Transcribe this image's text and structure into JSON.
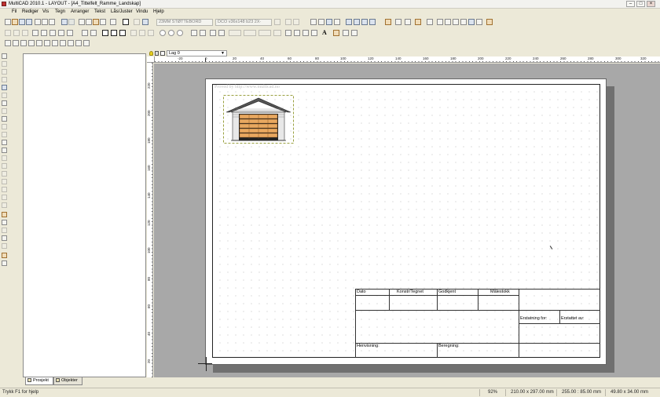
{
  "window": {
    "title": "MultiCAD 2010.1 - LAYOUT - [A4_Tittelfelt_Ramme_Landskap]",
    "buttons": [
      "–",
      "□",
      "×"
    ]
  },
  "menu": [
    "Fil",
    "Rediger",
    "Vis",
    "Tegn",
    "Arranger",
    "Tekst",
    "Lås/Juster",
    "Vindu",
    "Hjelp"
  ],
  "toolbar2": {
    "combo1": "23MM STØTTEBORD",
    "combo2": "DCO v36x148 b23 2X·",
    "text_tool": "A"
  },
  "draw_toolbar": {
    "layer": "Lag 0"
  },
  "ruler": {
    "h_labels": [
      "-20",
      "0",
      "20",
      "40",
      "60",
      "80",
      "100",
      "120",
      "140",
      "160",
      "180",
      "200",
      "220",
      "240",
      "260",
      "280",
      "300",
      "320"
    ],
    "v_labels": [
      "220",
      "200",
      "180",
      "160",
      "140",
      "120",
      "100",
      "80",
      "60",
      "40",
      "20",
      "0"
    ]
  },
  "drawing": {
    "watermark": "Proved by http://www.multicad.no"
  },
  "titleblock": {
    "dato": "Dato",
    "konstr": "Konstr/Tegnet",
    "godkjent": "Godkjent",
    "malestokk": "Målestokk",
    "erstatning": "Erstatning for:",
    "erstattet": "Erstattet av:",
    "henvisning": "Henvisning:",
    "beregning": "Beregning:"
  },
  "panel_tabs": {
    "prosjekt": "Prosjekt",
    "objekter": "Objekter"
  },
  "statusbar": {
    "hint": "Trykk F1 for hjelp",
    "zoom": "92%",
    "page_size": "210.00 x 297.00 mm",
    "coords": "255.00 : 85.00 mm",
    "size": "49.80 x 34.00 mm"
  }
}
